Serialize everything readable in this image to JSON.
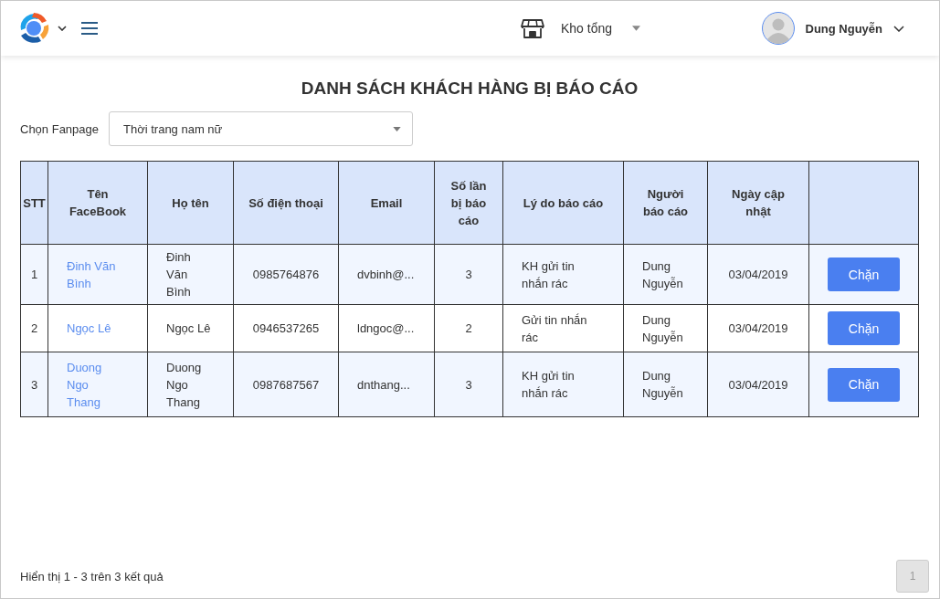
{
  "header": {
    "store": {
      "label": "Kho tổng"
    },
    "user": {
      "name": "Dung Nguyễn"
    }
  },
  "title": "DANH SÁCH KHÁCH HÀNG BỊ BÁO CÁO",
  "fanpage": {
    "label": "Chọn Fanpage",
    "value": "Thời trang nam nữ"
  },
  "table": {
    "columns": [
      "STT",
      "Tên FaceBook",
      "Họ tên",
      "Số điện thoại",
      "Email",
      "Số lần bị báo cáo",
      "Lý do báo cáo",
      "Người báo cáo",
      "Ngày cập nhật"
    ],
    "rows": [
      {
        "stt": "1",
        "facebook": "Đinh Văn Bình",
        "name": "Đinh Văn Bình",
        "phone": "0985764876",
        "email": "dvbinh@...",
        "count": "3",
        "reason": "KH gửi tin nhắn rác",
        "reporter": "Dung Nguyễn",
        "date": "03/04/2019",
        "action": "Chặn"
      },
      {
        "stt": "2",
        "facebook": "Ngọc Lê",
        "name": "Ngọc Lê",
        "phone": "0946537265",
        "email": "ldngoc@...",
        "count": "2",
        "reason": "Gửi tin nhắn rác",
        "reporter": "Dung Nguyễn",
        "date": "03/04/2019",
        "action": "Chặn"
      },
      {
        "stt": "3",
        "facebook": "Duong Ngo Thang",
        "name": "Duong Ngo Thang",
        "phone": "0987687567",
        "email": "dnthang...",
        "count": "3",
        "reason": "KH gửi tin nhắn rác",
        "reporter": "Dung Nguyễn",
        "date": "03/04/2019",
        "action": "Chặn"
      }
    ]
  },
  "footer": {
    "summary": "Hiển thị 1 - 3 trên 3 kết quả",
    "pages": [
      {
        "label": "1",
        "selected": true
      }
    ]
  }
}
